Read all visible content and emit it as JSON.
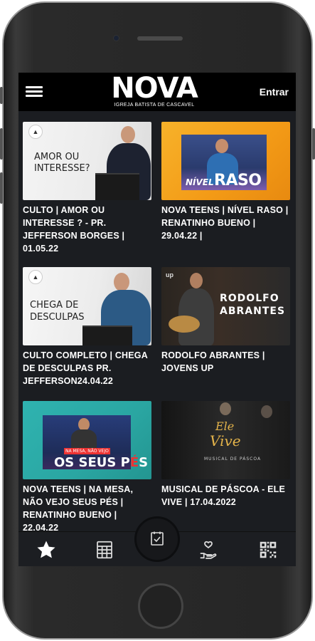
{
  "header": {
    "logo_text": "NOVA",
    "logo_subtitle": "IGREJA BATISTA DE CASCAVEL",
    "enter_label": "Entrar"
  },
  "videos": [
    {
      "title": "CULTO | AMOR OU INTERESSE ? - PR. JEFFERSON BORGES | 01.05.22",
      "thumb_text": "AMOR OU INTERESSE?"
    },
    {
      "title": "NOVA TEENS | NÍVEL RASO | RENATINHO BUENO | 29.04.22 |",
      "thumb_text_1": "NÍVEL",
      "thumb_text_2": "RASO"
    },
    {
      "title": "CULTO COMPLETO | CHEGA DE DESCULPAS PR. JEFFERSON24.04.22",
      "thumb_text_1": "CHEGA DE",
      "thumb_text_2": "DESCULPAS"
    },
    {
      "title": "RODOLFO ABRANTES | JOVENS UP",
      "thumb_text_1": "RODOLFO",
      "thumb_text_2": "ABRANTES"
    },
    {
      "title": "NOVA TEENS | NA MESA, NÃO VEJO SEUS PÉS | RENATINHO BUENO | 22.04.22",
      "thumb_text_1": "NA MESA, NÃO VEJO",
      "thumb_text_2": "OS SEUS P",
      "thumb_text_3": "É",
      "thumb_text_4": "S"
    },
    {
      "title": "MUSICAL DE PÁSCOA - ELE VIVE | 17.04.2022",
      "thumb_text_1": "Ele",
      "thumb_text_2": "Vive",
      "thumb_text_3": "MUSICAL DE PÁSCOA"
    }
  ],
  "bottom_nav": {
    "items": [
      "star-icon",
      "calendar-grid-icon",
      "checklist-icon",
      "donate-hand-icon",
      "qr-code-icon"
    ]
  },
  "colors": {
    "screen_bg": "#1b1d21",
    "header_bg": "#000000",
    "teens_orange": "#f4a21a",
    "teens_teal": "#2fb3b0"
  }
}
